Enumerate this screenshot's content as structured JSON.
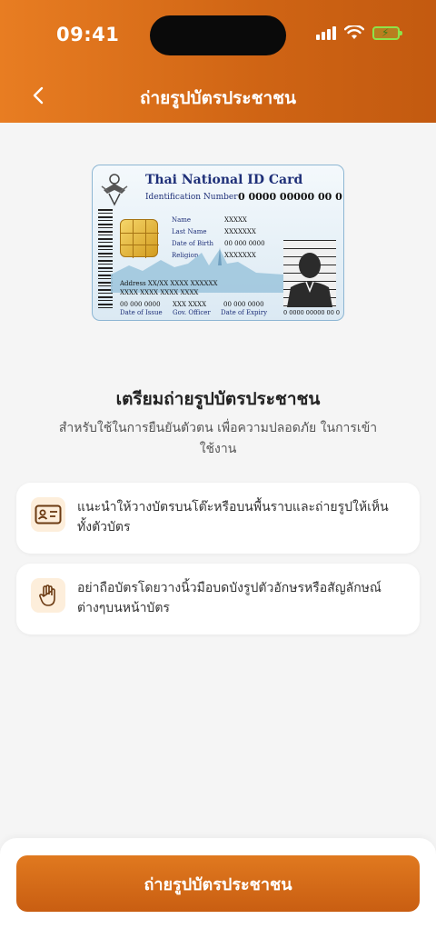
{
  "status_bar": {
    "time": "09:41"
  },
  "header": {
    "title": "ถ่ายรูปบัตรประชาชน"
  },
  "id_card": {
    "title": "Thai National ID Card",
    "id_label": "Identification Number",
    "id_value": "0 0000 00000 00 0",
    "name_label": "Name",
    "name_value": "XXXXX",
    "lastname_label": "Last Name",
    "lastname_value": "XXXXXXX",
    "dob_label": "Date of Birth",
    "dob_value": "00 000 0000",
    "religion_label": "Religion",
    "religion_value": "XXXXXXX",
    "address_line1": "Address XX/XX XXXX XXXXXX",
    "address_line2": "XXXX XXXX XXXX XXXX",
    "issue_value": "00 000 0000",
    "issue_label": "Date of Issue",
    "officer_value": "XXX XXXX",
    "officer_label": "Gov. Officer",
    "expiry_value": "00 000 0000",
    "expiry_label": "Date of Expiry",
    "serial": "0 0000 00000 00 0"
  },
  "main": {
    "headline": "เตรียมถ่ายรูปบัตรประชาชน",
    "subtitle": "สำหรับใช้ในการยืนยันตัวตน เพื่อความปลอดภัย ในการเข้าใช้งาน"
  },
  "tips": [
    {
      "icon": "id-card-icon",
      "text": "แนะนำให้วางบัตรบนโต๊ะหรือบนพื้นราบและถ่ายรูปให้เห็นทั้งตัวบัตร"
    },
    {
      "icon": "hand-icon",
      "text": "อย่าถือบัตรโดยวางนิ้วมือบดบังรูปตัวอักษรหรือสัญลักษณ์ต่างๆบนหน้าบัตร"
    }
  ],
  "footer": {
    "button_label": "ถ่ายรูปบัตรประชาชน"
  },
  "colors": {
    "accent": "#d86c18",
    "accent_light": "#fdeedb",
    "battery": "#8ee34a"
  }
}
